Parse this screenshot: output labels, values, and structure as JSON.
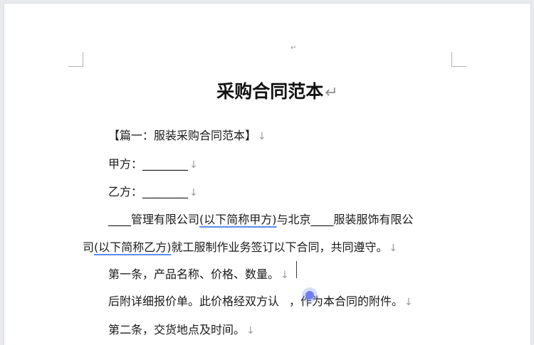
{
  "document": {
    "top_mark": "↵",
    "title": "采购合同范本",
    "title_mark": "↵",
    "para_mark": "↓",
    "lines": {
      "l1": "【篇一：服装采购合同范本】",
      "l2": "甲方：________",
      "l3": "乙方：________",
      "l4a": "____管理有限公司",
      "l4b": "(以下简称甲方)",
      "l4c": "与北京____服装服饰有限公",
      "l5a": "司",
      "l5b": "(以下简称乙方)",
      "l5c": "就工服制作业务签订以下合同，共同遵守。",
      "l6": "第一条，产品名称、价格、数量。",
      "l7a": "后附详细报价单。此价格经双方认",
      "l7b": "，作为本合同的附件。",
      "l8": "第二条，交货地点及时间。"
    }
  }
}
